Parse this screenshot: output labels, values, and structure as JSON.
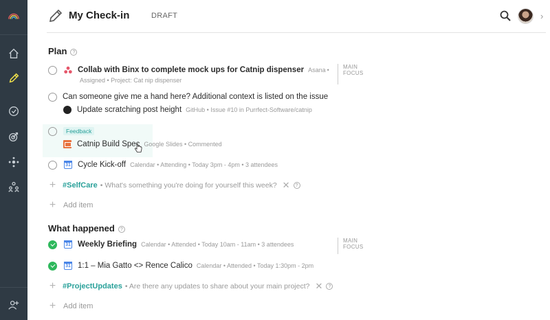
{
  "header": {
    "title": "My Check-in",
    "status": "DRAFT"
  },
  "plan": {
    "title": "Plan",
    "items": [
      {
        "text": "Collab with Binx to complete mock ups for Catnip dispenser",
        "source": "Asana",
        "meta": "Assigned • Project: Cat nip dispenser",
        "icon": "asana-icon"
      },
      {
        "text": "Can someone give me a hand here? Additional context is listed on the issue",
        "sub_text": "Update scratching post height",
        "sub_meta": "GitHub • Issue #10 in Purrfect-Software/catnip",
        "icon": "github-icon"
      },
      {
        "badge": "Feedback",
        "text": "Catnip Build Spec",
        "meta": "Google Slides • Commented",
        "icon": "google-slides-icon"
      },
      {
        "text": "Cycle Kick-off",
        "meta": "Calendar • Attending • Today 3pm - 4pm • 3 attendees",
        "icon": "calendar-icon"
      }
    ],
    "main_focus": [
      "MAIN",
      "FOCUS"
    ],
    "prompt": {
      "tag": "#SelfCare",
      "question": "• What's something you're doing for yourself this week?"
    },
    "add_item": "Add item"
  },
  "happened": {
    "title": "What happened",
    "items": [
      {
        "text": "Weekly Briefing",
        "meta": "Calendar • Attended • Today 10am - 11am • 3 attendees",
        "icon": "calendar-icon",
        "done": true
      },
      {
        "text": "1:1 – Mia Gatto <> Rence Calico",
        "meta": "Calendar • Attended • Today 1:30pm - 2pm",
        "icon": "calendar-icon",
        "done": true
      }
    ],
    "main_focus": [
      "MAIN",
      "FOCUS"
    ],
    "prompt": {
      "tag": "#ProjectUpdates",
      "question": "• Are there any updates to share about your main project?"
    },
    "add_item": "Add item"
  },
  "calendar_day": "31",
  "colors": {
    "sidebar": "#2f3a44",
    "accent": "#2aa19a",
    "done": "#2eb85c",
    "active_icon": "#f3e34a"
  }
}
